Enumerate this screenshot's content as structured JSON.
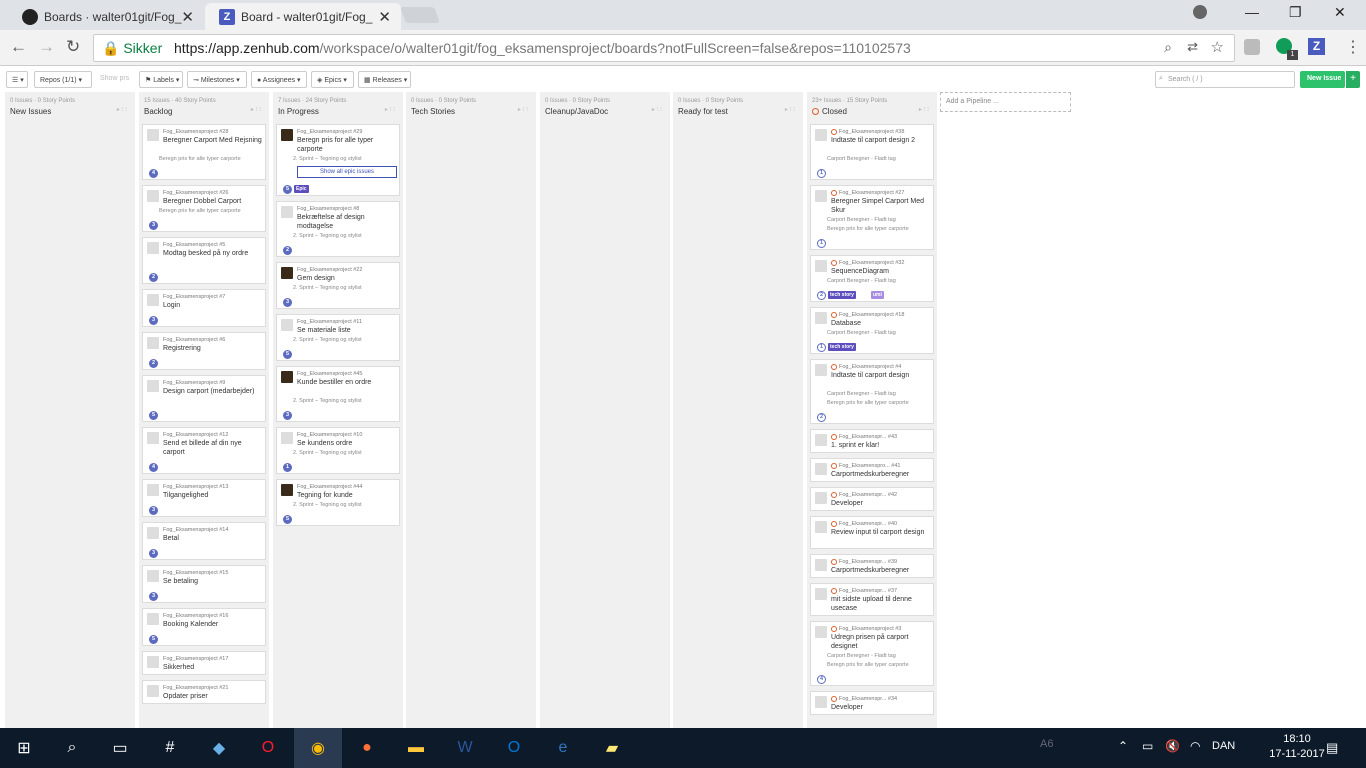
{
  "browser": {
    "tabs": [
      {
        "label": "Boards · walter01git/Fog_",
        "icon": "github-icon"
      },
      {
        "label": "Board - walter01git/Fog_",
        "icon": "zenhub-icon"
      }
    ],
    "secure_label": "Sikker",
    "url_host": "https://app.zenhub.com",
    "url_path": "/workspace/o/walter01git/fog_eksamensproject/boards?notFullScreen=false&repos=110102573",
    "extension_badge": "1"
  },
  "toolbar": {
    "repos": "Repos (1/1)",
    "show_prs": "Show prs",
    "labels": "Labels",
    "milestones": "Milestones",
    "assignees": "Assignees",
    "epics": "Epics",
    "releases": "Releases",
    "search_placeholder": "Search ( / )",
    "new_issue": "New Issue",
    "plus": "+"
  },
  "pipelines": [
    {
      "meta": "0 Issues · 0 Story Points",
      "name": "New Issues"
    },
    {
      "meta": "15 Issues · 40 Story Points",
      "name": "Backlog"
    },
    {
      "meta": "7 Issues · 24 Story Points",
      "name": "In Progress"
    },
    {
      "meta": "0 Issues · 0 Story Points",
      "name": "Tech Stories"
    },
    {
      "meta": "0 Issues · 0 Story Points",
      "name": "Cleanup/JavaDoc"
    },
    {
      "meta": "0 Issues · 0 Story Points",
      "name": "Ready for test"
    },
    {
      "meta": "23+ Issues · 15 Story Points",
      "name": "Closed"
    }
  ],
  "add_pipeline": "Add a Pipeline ...",
  "backlog": [
    {
      "repo": "Fog_Eksamensproject #28",
      "title": "Beregner Carport Med Rejsning",
      "sub": "Beregn pris for alle typer carporte",
      "est": "4"
    },
    {
      "repo": "Fog_Eksamensproject #26",
      "title": "Beregner Dobbel Carport",
      "sub": "Beregn pris for alle typer carporte",
      "est": "3"
    },
    {
      "repo": "Fog_Eksamensproject #5",
      "title": "Modtag besked på ny ordre",
      "sub": "",
      "est": "2"
    },
    {
      "repo": "Fog_Eksamensproject #7",
      "title": "Login",
      "sub": "",
      "est": "3"
    },
    {
      "repo": "Fog_Eksamensproject #6",
      "title": "Registrering",
      "sub": "",
      "est": "2"
    },
    {
      "repo": "Fog_Eksamensproject #9",
      "title": "Design carport (medarbejder)",
      "sub": "",
      "est": "5"
    },
    {
      "repo": "Fog_Eksamensproject #12",
      "title": "Send et billede af din nye carport",
      "sub": "",
      "est": "4"
    },
    {
      "repo": "Fog_Eksamensproject #13",
      "title": "Tilgangelighed",
      "sub": "",
      "est": "3"
    },
    {
      "repo": "Fog_Eksamensproject #14",
      "title": "Betal",
      "sub": "",
      "est": "3"
    },
    {
      "repo": "Fog_Eksamensproject #15",
      "title": "Se betaling",
      "sub": "",
      "est": "3"
    },
    {
      "repo": "Fog_Eksamensproject #16",
      "title": "Booking Kalender",
      "sub": "",
      "est": "5"
    },
    {
      "repo": "Fog_Eksamensproject #17",
      "title": "Sikkerhed",
      "sub": "",
      "est": ""
    },
    {
      "repo": "Fog_Eksamensproject #21",
      "title": "Opdater priser",
      "sub": "",
      "est": ""
    }
  ],
  "inprogress": [
    {
      "repo": "Fog_Eksamensproject #29",
      "title": "Beregn pris for alle typer carporte",
      "sub": "2. Sprint – Tegning og stylist",
      "est": "5",
      "epic_button": "Show all epic issues",
      "label": "Epic"
    },
    {
      "repo": "Fog_Eksamensproject #8",
      "title": "Bekræftelse af design modtagelse",
      "sub": "2. Sprint – Tegning og stylist",
      "est": "2"
    },
    {
      "repo": "Fog_Eksamensproject #22",
      "title": "Gem design",
      "sub": "2. Sprint – Tegning og stylist",
      "est": "3"
    },
    {
      "repo": "Fog_Eksamensproject #11",
      "title": "Se materiale liste",
      "sub": "2. Sprint – Tegning og stylist",
      "est": "5"
    },
    {
      "repo": "Fog_Eksamensproject #45",
      "title": "Kunde bestiller en ordre",
      "sub": "2. Sprint – Tegning og stylist",
      "est": "3"
    },
    {
      "repo": "Fog_Eksamensproject #10",
      "title": "Se kundens ordre",
      "sub": "2. Sprint – Tegning og stylist",
      "est": "1"
    },
    {
      "repo": "Fog_Eksamensproject #44",
      "title": "Tegning for kunde",
      "sub": "2. Sprint – Tegning og stylist",
      "est": "5"
    }
  ],
  "closed": [
    {
      "repo": "Fog_Eksamensproject #38",
      "title": "Indtaste til carport design 2",
      "sub": "Carport Beregner - Fladt tag",
      "sub2": "",
      "est": "1",
      "labels": []
    },
    {
      "repo": "Fog_Eksamensproject #27",
      "title": "Beregner Simpel Carport Med Skur",
      "sub": "Carport Beregner - Fladt tag",
      "sub2": "Beregn pris for alle typer carporte",
      "est": "1",
      "labels": []
    },
    {
      "repo": "Fog_Eksamensproject #32",
      "title": "SequenceDiagram",
      "sub": "Carport Beregner - Fladt tag",
      "sub2": "",
      "est": "2",
      "labels": [
        "tech story",
        "uml"
      ]
    },
    {
      "repo": "Fog_Eksamensproject #18",
      "title": "Database",
      "sub": "Carport Beregner - Fladt tag",
      "sub2": "",
      "est": "1",
      "labels": [
        "tech story"
      ]
    },
    {
      "repo": "Fog_Eksamensproject #4",
      "title": "Indtaste til carport design",
      "sub": "Carport Beregner - Fladt tag",
      "sub2": "Beregn pris for alle typer carporte",
      "est": "2",
      "labels": []
    },
    {
      "repo": "Fog_Eksamenspr...   #43",
      "title": "1. sprint er klar!",
      "sub": "",
      "sub2": "",
      "est": "",
      "labels": []
    },
    {
      "repo": "Fog_Eksamenspro...  #41",
      "title": "Carportmedskurberegner",
      "sub": "",
      "sub2": "",
      "est": "",
      "labels": []
    },
    {
      "repo": "Fog_Eksamenspr...   #42",
      "title": "Developer",
      "sub": "",
      "sub2": "",
      "est": "",
      "labels": []
    },
    {
      "repo": "Fog_Eksamenspr...   #40",
      "title": "Review input til carport design",
      "sub": "",
      "sub2": "",
      "est": "",
      "labels": []
    },
    {
      "repo": "Fog_Eksamenspr...   #39",
      "title": "Carportmedskurberegner",
      "sub": "",
      "sub2": "",
      "est": "",
      "labels": []
    },
    {
      "repo": "Fog_Eksamenspr...   #37",
      "title": "mit sidste upload til denne usecase",
      "sub": "",
      "sub2": "",
      "est": "",
      "labels": []
    },
    {
      "repo": "Fog_Eksamensproject #3",
      "title": "Udregn prisen på carport designet",
      "sub": "Carport Beregner - Fladt tag",
      "sub2": "Beregn pris for alle typer carporte",
      "est": "4",
      "labels": []
    },
    {
      "repo": "Fog_Eksamenspr...   #34",
      "title": "Developer",
      "sub": "",
      "sub2": "",
      "est": "",
      "labels": []
    }
  ],
  "taskbar": {
    "lang": "DAN",
    "time": "18:10",
    "date": "17-11-2017",
    "ghost": "A6"
  }
}
